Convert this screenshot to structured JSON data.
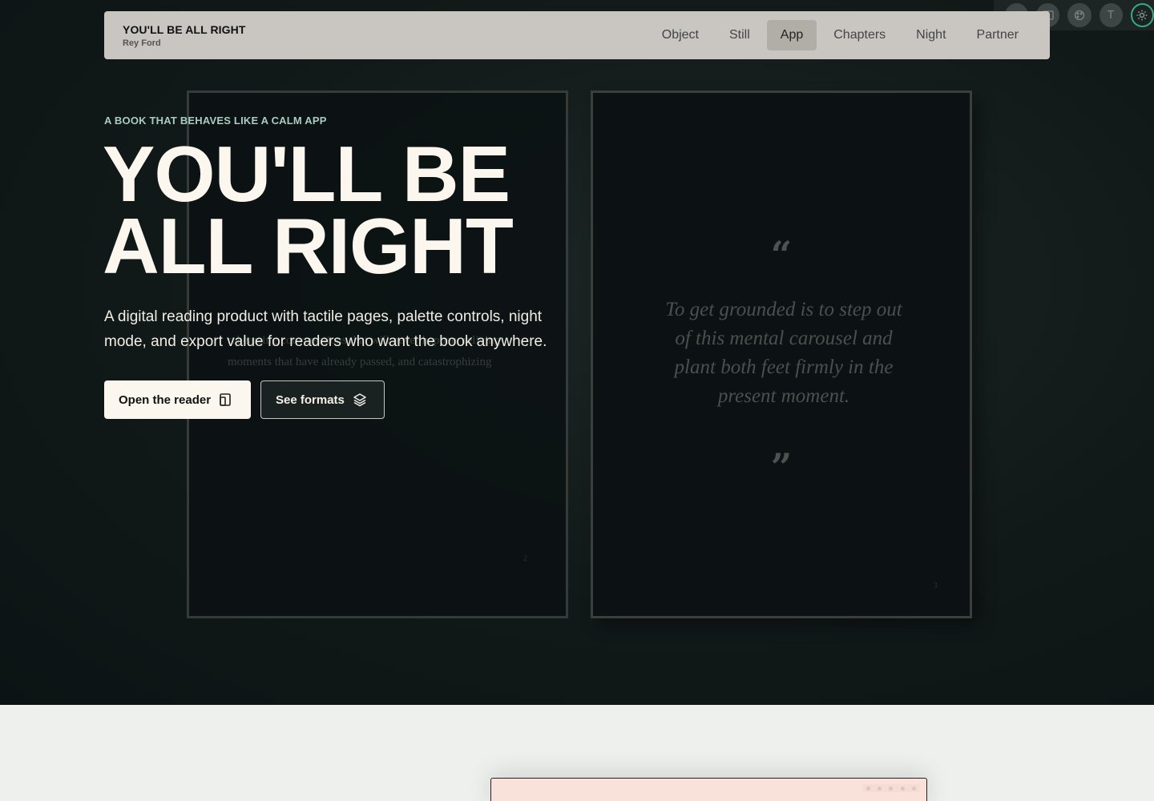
{
  "nav": {
    "title": "YOU'LL BE ALL RIGHT",
    "author": "Rey Ford",
    "links": [
      "Object",
      "Still",
      "App",
      "Chapters",
      "Night",
      "Partner"
    ],
    "active": "App"
  },
  "hero": {
    "eyebrow": "A BOOK THAT BEHAVES LIKE A CALM APP",
    "headline_line1": "YOU'LL BE",
    "headline_line2": "ALL RIGHT",
    "lede": "A digital reading product with tactile pages, palette controls, night mode, and export value for readers who want the book anywhere.",
    "primary_button": "Open the reader",
    "secondary_button": "See formats"
  },
  "book": {
    "left_page_body": "rehearsing conversations that will never happen, reliving moments that have already passed, and catastrophizing",
    "left_page_number": "2",
    "quote_open": "“",
    "quote": "To get grounded is to step out of this mental carousel and plant both feet firmly in the present moment.",
    "quote_close": "”",
    "right_page_number": "3"
  },
  "tools": {
    "icons": [
      "download-icon",
      "book-icon",
      "palette-icon",
      "type-icon",
      "sun-icon"
    ],
    "type_glyph": "T"
  },
  "colors": {
    "hero_bg": "#111918",
    "nav_bg": "#c9c6c1",
    "eyebrow": "#a9ccc0",
    "headline": "#fbf7ee",
    "accent_ring": "#3aa88a",
    "preview_bg": "#f9e2da"
  }
}
